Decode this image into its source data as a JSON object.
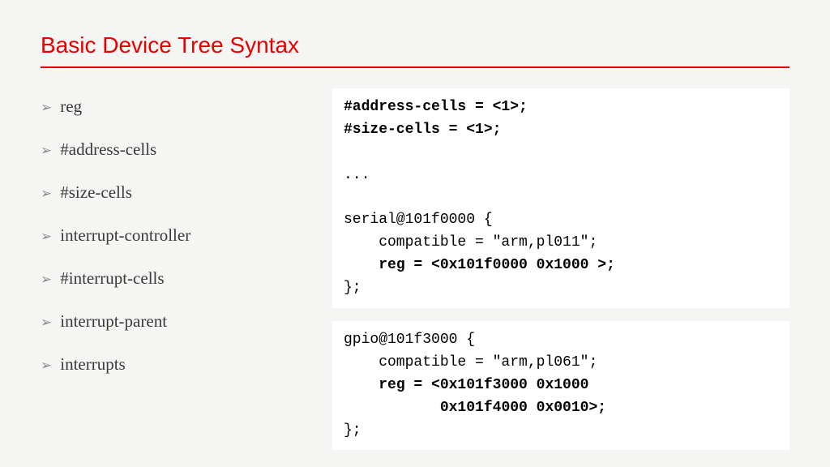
{
  "title": "Basic Device Tree Syntax",
  "bullets": {
    "b0": "reg",
    "b1": "#address-cells",
    "b2": "#size-cells",
    "b3": "interrupt-controller",
    "b4": "#interrupt-cells",
    "b5": "interrupt-parent",
    "b6": "interrupts"
  },
  "code1": {
    "l1a": "#address-cells = <1>;",
    "l1b": "#size-cells = <1>;",
    "l2": "...",
    "l3": "serial@101f0000 {",
    "l4": "    compatible = \"arm,pl011\";",
    "l5a": "    ",
    "l5b": "reg = <0x101f0000 0x1000 >;",
    "l6": "};"
  },
  "code2": {
    "l1": "gpio@101f3000 {",
    "l2": "    compatible = \"arm,pl061\";",
    "l3a": "    ",
    "l3b": "reg = <0x101f3000 0x1000",
    "l4a": "           ",
    "l4b": "0x101f4000 0x0010>;",
    "l5": "};"
  }
}
